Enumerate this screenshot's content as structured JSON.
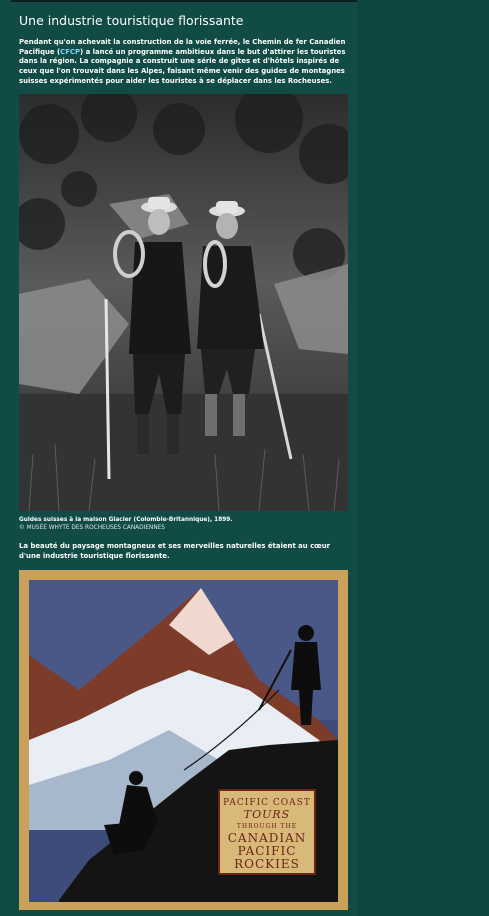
{
  "article": {
    "heading": "Une industrie touristique florissante",
    "intro_before_link": "Pendant qu'on achevait la construction de la voie ferrée, le Chemin de fer Canadien Pacifique (",
    "intro_link": "CFCP",
    "intro_after_link": ") a lancé un programme ambitieux dans le but d'attirer les touristes dans la région. La compagnie a construit une série de gîtes et d'hôtels inspirés de ceux que l'on trouvait dans les Alpes, faisant même venir des guides de montagnes suisses expérimentés pour aider les touristes à se déplacer dans les Rocheuses.",
    "photo_caption": "Guides suisses à la maison Glacier (Colombie-Britannique), 1899.",
    "photo_credit": "© MUSÉE WHYTE DES ROCHEUSES CANADIENNES",
    "paragraph2": "La beauté du paysage montagneux et ses merveilles naturelles étaient au cœur d'une industrie touristique florissante."
  },
  "poster": {
    "line1": "PACIFIC COAST",
    "line2": "TOURS",
    "line3": "THROUGH THE",
    "line4": "CANADIAN",
    "line5": "PACIFIC",
    "line6": "ROCKIES"
  },
  "colors": {
    "page_bg": "#0f4a45",
    "text": "#ffffff",
    "link": "#7fd0ff"
  }
}
